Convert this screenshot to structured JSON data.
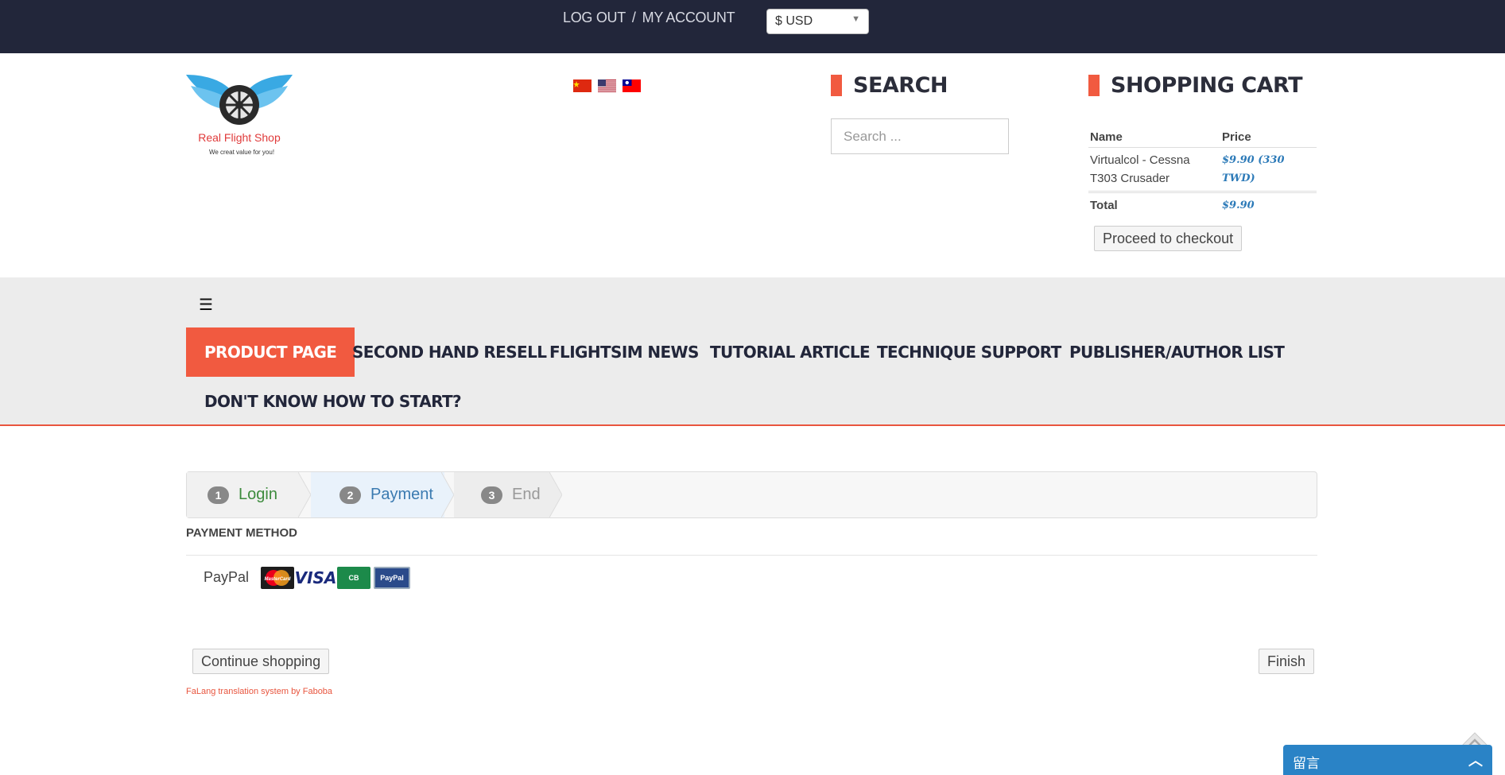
{
  "topbar": {
    "logout": "LOG OUT",
    "separator": "/",
    "my_account": "MY ACCOUNT",
    "currency": "$ USD",
    "dropdown_icon": "caret-down-icon"
  },
  "header": {
    "logo_name": "Real Flight Shop",
    "logo_tagline": "We creat value for you!",
    "flags": [
      "china-flag",
      "usa-flag",
      "taiwan-flag"
    ],
    "search_title": "SEARCH",
    "search_placeholder": "Search ...",
    "cart_title": "SHOPPING CART"
  },
  "cart": {
    "col_name": "Name",
    "col_price": "Price",
    "item_name": "Virtualcol - Cessna T303 Crusader",
    "item_price": "$9.90 (330 TWD)",
    "total_label": "Total",
    "total_value": "$9.90",
    "checkout_label": "Proceed to checkout"
  },
  "nav": {
    "menu_icon": "hamburger-icon",
    "items": [
      "PRODUCT PAGE",
      "SECOND HAND RESELL",
      "FLIGHTSIM NEWS",
      "TUTORIAL ARTICLE",
      "TECHNIQUE SUPPORT",
      "PUBLISHER/AUTHOR LIST",
      "DON'T KNOW HOW TO START?"
    ],
    "active_index": 0
  },
  "steps": [
    {
      "num": "1",
      "label": "Login"
    },
    {
      "num": "2",
      "label": "Payment"
    },
    {
      "num": "3",
      "label": "End"
    }
  ],
  "payment": {
    "title": "PAYMENT METHOD",
    "method": "PayPal",
    "card_icons": [
      "mastercard-icon",
      "visa-icon",
      "cb-icon",
      "paypal-icon"
    ],
    "card_mc_text": "MasterCard",
    "card_visa_text": "VISA",
    "card_cb_text": "CB",
    "card_pp_text": "PayPal"
  },
  "actions": {
    "continue": "Continue shopping",
    "finish": "Finish"
  },
  "footer": {
    "falang": "FaLang translation system by Faboba"
  },
  "chat": {
    "label": "留言",
    "collapse_icon": "chevron-up-icon"
  },
  "colors": {
    "topbar_bg": "#22263a",
    "accent": "#f15a40",
    "nav_bg": "#ececec",
    "price_blue": "#2c7ab8",
    "chat_blue": "#2a83c6"
  }
}
